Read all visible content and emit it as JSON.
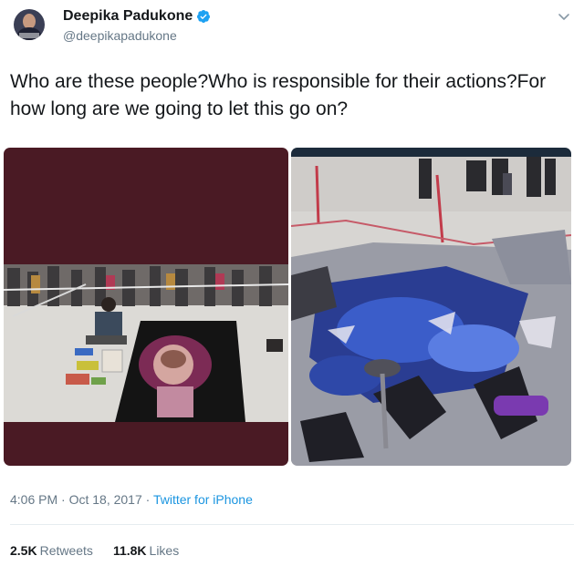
{
  "user": {
    "display_name": "Deepika Padukone",
    "handle": "@deepikapadukone",
    "verified": true
  },
  "tweet": {
    "text": "Who are these people?Who is responsible for their actions?For how long are we going to let this go on?",
    "timestamp": "4:06 PM · Oct 18, 2017 · ",
    "source": "Twitter for iPhone"
  },
  "stats": {
    "retweets_count": "2.5K",
    "retweets_label": "Retweets",
    "likes_count": "11.8K",
    "likes_label": "Likes"
  },
  "icons": {
    "verified": "verified-badge-icon",
    "menu": "chevron-down-icon"
  },
  "colors": {
    "verified_blue": "#1da1f2",
    "link_blue": "#1b95e0",
    "secondary_text": "#657786",
    "media_dark": "#4a1a24"
  }
}
